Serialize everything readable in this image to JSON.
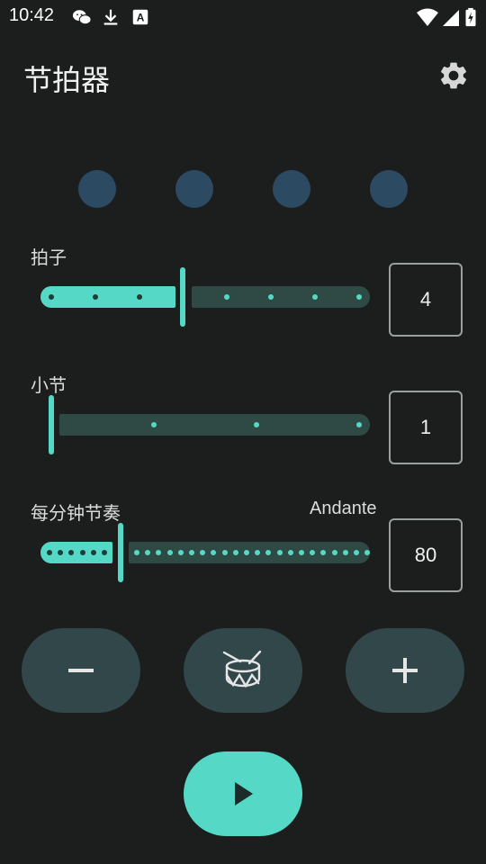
{
  "status_bar": {
    "time": "10:42",
    "icons": [
      "wechat-icon",
      "download-icon",
      "a-box-icon",
      "wifi-icon",
      "signal-icon",
      "battery-icon"
    ]
  },
  "app_bar": {
    "title": "节拍器",
    "settings_icon": "gear-icon"
  },
  "beat_indicators": {
    "count": 4,
    "color": "#2d4a63"
  },
  "beats_control": {
    "label": "拍子",
    "value": "4",
    "slider_value": 4,
    "slider_range": [
      1,
      8
    ]
  },
  "bars_control": {
    "label": "小节",
    "value": "1",
    "slider_value": 1,
    "slider_range": [
      1,
      4
    ]
  },
  "tempo_control": {
    "label": "每分钟节奏",
    "tempo_name": "Andante",
    "value": "80",
    "slider_value": 80
  },
  "buttons": {
    "decrease_icon": "minus-icon",
    "sound_icon": "drum-icon",
    "increase_icon": "plus-icon",
    "play_icon": "play-icon"
  },
  "colors": {
    "background": "#1c1e1e",
    "accent": "#55d9c6",
    "track_inactive": "#2f4a44",
    "button": "#31474a"
  }
}
